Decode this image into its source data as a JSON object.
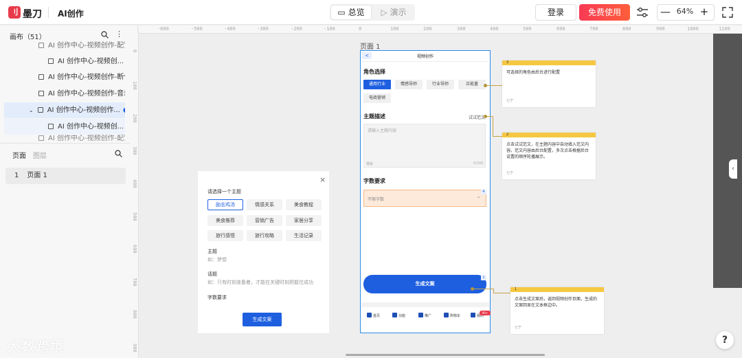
{
  "topbar": {
    "logo_mark": "刂",
    "brand": "墨刀",
    "app_title": "AI创作",
    "overview_tab": "总览",
    "present_tab": "演示",
    "login_label": "登录",
    "free_use_label": "免费使用",
    "zoom_minus": "—",
    "zoom_value": "64%",
    "zoom_plus": "+"
  },
  "sidebar": {
    "canvas_header": "画布（51）",
    "tree": [
      "AI 创作中心-视频创作-配置",
      "AI 创作中心-视频创...",
      "AI 创作中心-视频创作-断句",
      "AI 创作中心-视频创作-音乐",
      "AI 创作中心-视频创作...",
      "AI 创作中心-视频创...",
      "AI 创作中心-视频创作-配置"
    ],
    "pages_tab": "页面",
    "layers_tab": "图层",
    "page_index": "1",
    "page_name": "页面 1"
  },
  "rulers": {
    "top": [
      "-600",
      "-550",
      "-500",
      "-450",
      "-400",
      "-350",
      "-300",
      "-250",
      "-200",
      "-150",
      "-100",
      "0",
      "50",
      "100",
      "150",
      "200",
      "250",
      "300",
      "350",
      "400",
      "450",
      "500",
      "550",
      "600",
      "650",
      "700",
      "750",
      "800",
      "850",
      "900",
      "950",
      "1000",
      "1050",
      "1100"
    ],
    "left": [
      "0",
      "100",
      "200",
      "300",
      "400",
      "500",
      "600",
      "700",
      "800",
      "900"
    ]
  },
  "theme_card": {
    "close": "×",
    "title": "请选择一个主题",
    "chips": [
      "励志鸡汤",
      "情感关系",
      "美食教程",
      "美食推荐",
      "营销广告",
      "家居分享",
      "旅行感悟",
      "旅行攻略",
      "生活记录"
    ],
    "topic_label": "主题",
    "topic_hint": "如：梦想",
    "subject_label": "话题",
    "subject_hint": "如：只有时刻准备着，才能在关键时刻把握住成功",
    "word_label": "字数要求",
    "generate_label": "生成文案"
  },
  "phone": {
    "page_label": "页面 1",
    "back_badge": "<",
    "title": "视频创作",
    "role_heading": "角色选择",
    "roles": [
      "通用行业",
      "情感导师",
      "行业导师",
      "正能量",
      "电商营销"
    ],
    "topic_heading": "主题描述",
    "try_example": "试试范文",
    "textarea_placeholder": "请输入主题内容",
    "template_label": "模板",
    "char_count": "0/200",
    "wordcount_heading": "字数要求",
    "select_value": "不限字数",
    "select_badge": "4",
    "generate_label": "生成文案",
    "generate_badge": "1",
    "nav": [
      "首页",
      "功能",
      "推广",
      "购物车",
      "我的"
    ],
    "nav_badge": "99+"
  },
  "annotations": [
    {
      "num": "3",
      "text": "可选择的角色由后台进行配置",
      "author": "七宁"
    },
    {
      "num": "2",
      "text": "点击试试范文，在主题内容中自动填入范文内容。范文内容由后台配置，多次点击根据后台设置的顺序轮播展示。",
      "author": "七宁"
    },
    {
      "num": "1",
      "text": "点击生成文案后，返回视频创作页面，生成的文案回显在文本框边中。",
      "author": "七宁"
    }
  ],
  "watermark": "大数跨境",
  "help_label": "?",
  "collapse_label": "‹"
}
